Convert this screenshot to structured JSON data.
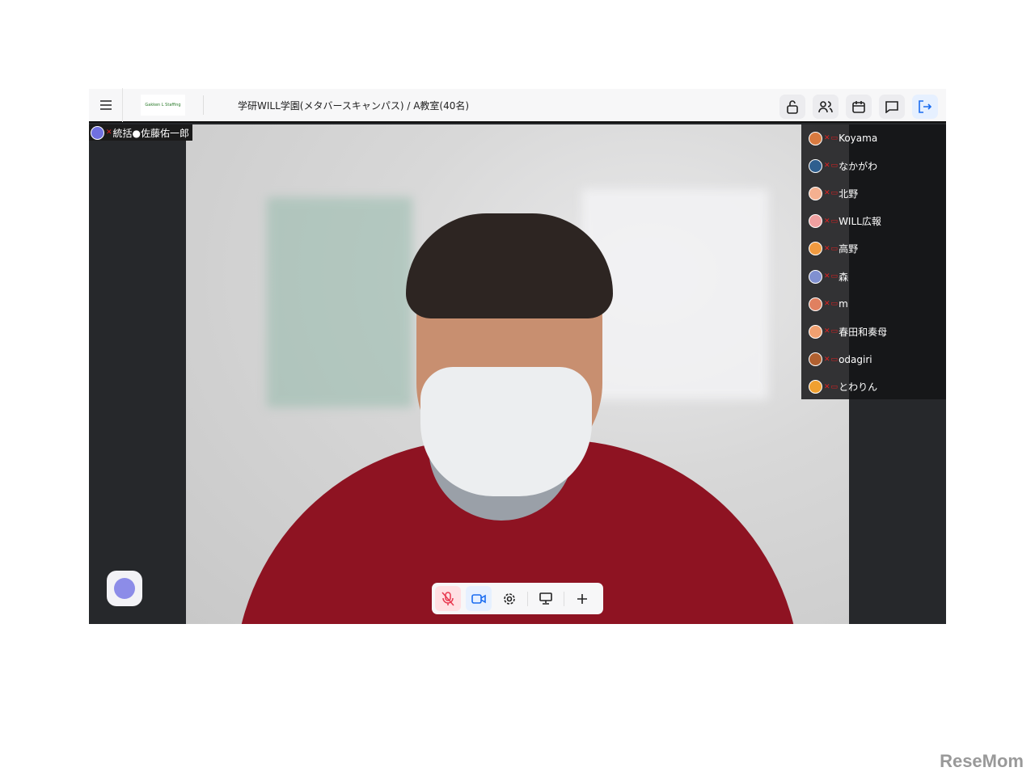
{
  "header": {
    "logo_text": "Gakken L Staffing",
    "title": "学研WILL学園(メタバースキャンパス) / A教室(40名)"
  },
  "toolbar": {
    "icons": [
      "lock-open-icon",
      "users-icon",
      "calendar-icon",
      "chat-icon",
      "exit-icon"
    ]
  },
  "self_tag": {
    "name": "統括●佐藤佑一郎"
  },
  "participants": [
    "Koyama",
    "なかがわ",
    "北野",
    "WILL広報",
    "高野",
    "森",
    "m",
    "春田和奏母",
    "odagiri",
    "とわりん"
  ],
  "controls": [
    "mic-off-icon",
    "camera-icon",
    "settings-icon",
    "screen-share-icon",
    "plus-icon"
  ],
  "watermark": "ReseMom",
  "colors": {
    "accent": "#1a6cf0",
    "mute": "#e02020"
  }
}
